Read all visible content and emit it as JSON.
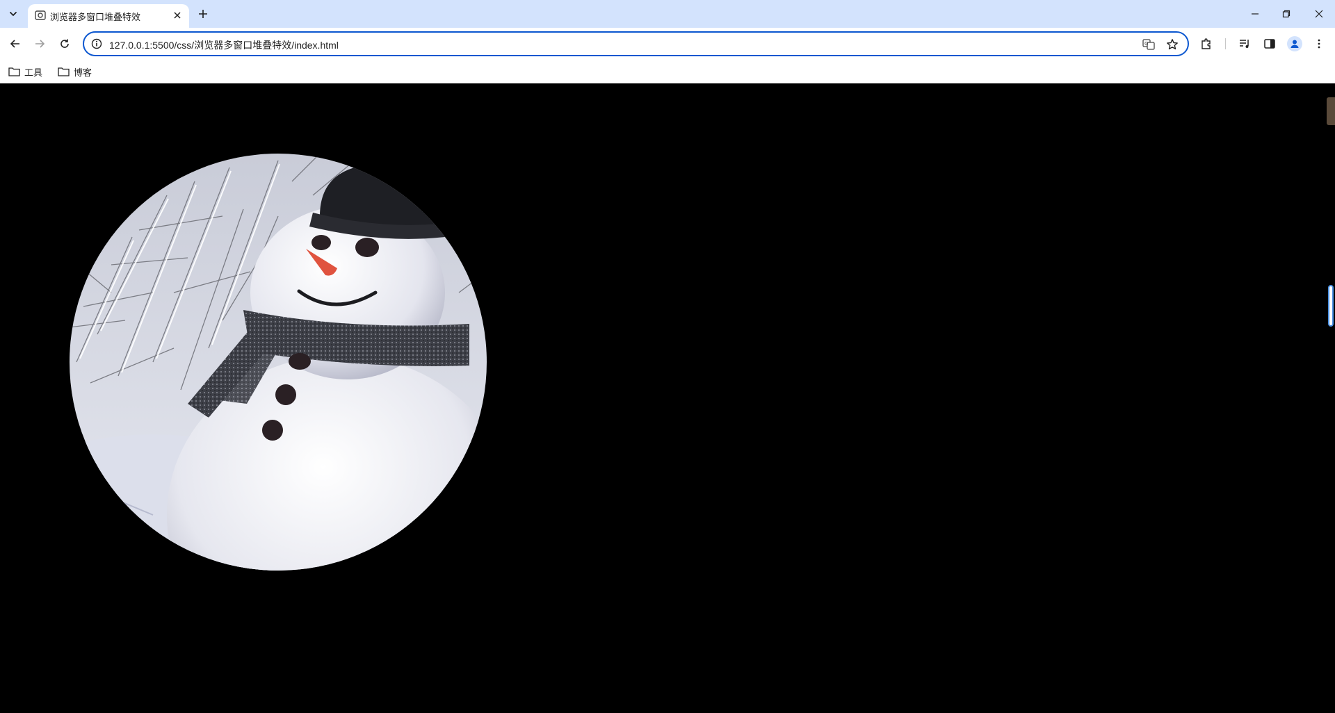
{
  "browser": {
    "tab": {
      "title": "浏览器多窗口堆叠特效"
    },
    "address_bar": {
      "url": "127.0.0.1:5500/css/浏览器多窗口堆叠特效/index.html"
    },
    "bookmarks": [
      {
        "label": "工具",
        "icon": "folder-icon"
      },
      {
        "label": "博客",
        "icon": "folder-icon"
      }
    ],
    "colors": {
      "tabstrip": "#d3e3fd",
      "omnibox_border": "#0b57d0",
      "page_background": "#000000"
    }
  },
  "page": {
    "image": {
      "subject": "snowman",
      "shape": "circle"
    }
  }
}
